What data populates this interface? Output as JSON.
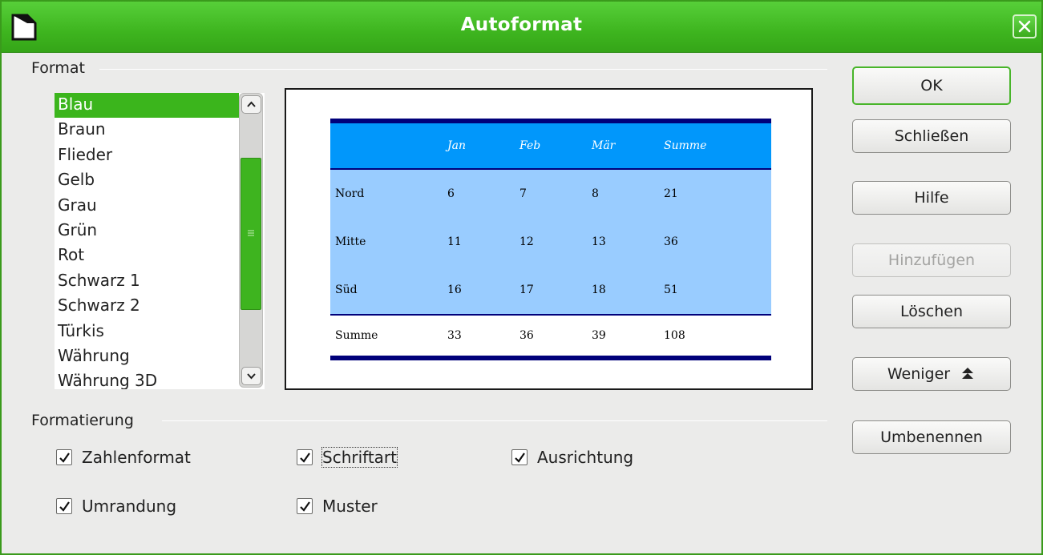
{
  "window": {
    "title": "Autoformat"
  },
  "format_group": {
    "label": "Format",
    "items": [
      "Blau",
      "Braun",
      "Flieder",
      "Gelb",
      "Grau",
      "Grün",
      "Rot",
      "Schwarz 1",
      "Schwarz 2",
      "Türkis",
      "Währung",
      "Währung 3D"
    ],
    "selected": "Blau"
  },
  "preview": {
    "columns": [
      "",
      "Jan",
      "Feb",
      "Mär",
      "Summe"
    ],
    "rows": [
      [
        "Nord",
        "6",
        "7",
        "8",
        "21"
      ],
      [
        "Mitte",
        "11",
        "12",
        "13",
        "36"
      ],
      [
        "Süd",
        "16",
        "17",
        "18",
        "51"
      ]
    ],
    "total": [
      "Summe",
      "33",
      "36",
      "39",
      "108"
    ]
  },
  "buttons": {
    "ok": "OK",
    "close": "Schließen",
    "help": "Hilfe",
    "add": "Hinzufügen",
    "delete": "Löschen",
    "less": "Weniger",
    "rename": "Umbenennen"
  },
  "formatting_group": {
    "label": "Formatierung",
    "options": {
      "number_format": {
        "label": "Zahlenformat",
        "checked": true
      },
      "font": {
        "label": "Schriftart",
        "checked": true
      },
      "alignment": {
        "label": "Ausrichtung",
        "checked": true
      },
      "border": {
        "label": "Umrandung",
        "checked": true
      },
      "pattern": {
        "label": "Muster",
        "checked": true
      }
    }
  },
  "colors": {
    "titlebar": "#3eb51f",
    "selection": "#3bb51c",
    "preview_header": "#0197fb",
    "preview_body": "#99ccff",
    "preview_rule": "#00007a"
  }
}
